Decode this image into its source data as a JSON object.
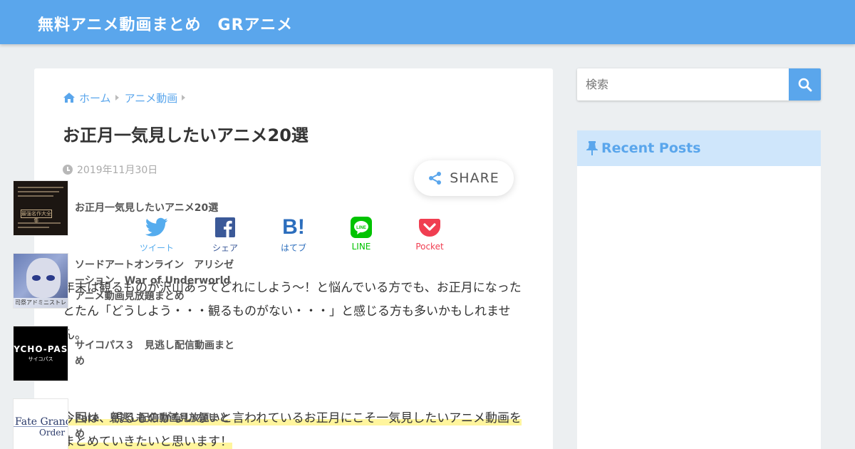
{
  "site": {
    "title": "無料アニメ動画まとめ　GRアニメ"
  },
  "breadcrumb": {
    "home": "ホーム",
    "category": "アニメ動画"
  },
  "post": {
    "title": "お正月一気見したいアニメ20選",
    "date": "2019年11月30日",
    "paragraph1": "年末は観るものが沢山あってどれにしよう～！と悩んでいる方でも、お正月になったとたん「どうしよう・・・観るものがない・・・」と感じる方も多いかもしれません。",
    "paragraph2": "今回は、観るものがないないと言われているお正月にこそ一気見したいアニメ動画をまとめていきたいと思います！"
  },
  "share": {
    "button_label": "SHARE",
    "items": [
      {
        "label": "ツイート",
        "icon": "twitter-icon",
        "color": "#55acee"
      },
      {
        "label": "シェア",
        "icon": "facebook-icon",
        "color": "#3b5998"
      },
      {
        "label": "はてブ",
        "icon": "hatena-bookmark-icon",
        "color": "#2c6ebd"
      },
      {
        "label": "LINE",
        "icon": "line-icon",
        "color": "#00c300"
      },
      {
        "label": "Pocket",
        "icon": "pocket-icon",
        "color": "#f03e51"
      }
    ]
  },
  "sidebar": {
    "search": {
      "placeholder": "検索"
    },
    "recent_posts": {
      "heading": "Recent Posts",
      "items": [
        {
          "title": "お正月一気見したいアニメ20選",
          "thumb_text": "最強名作大全集"
        },
        {
          "title": "ソードアートオンライン　アリシゼーション　War of Underworld　アニメ動画見放題まとめ",
          "thumb_text": "司祭アドミニストレータ"
        },
        {
          "title": "サイコパス３　見逃し配信動画まとめ",
          "thumb_text": "SYCHO-PASS",
          "thumb_subtext": "サイコパス"
        },
        {
          "title": "Fate　見逃し配信動画見放題まとめ",
          "thumb_text": "Fate Grand",
          "thumb_subtext": "Order"
        }
      ]
    }
  },
  "colors": {
    "accent": "#5aa6ec",
    "background": "#eceff1",
    "marker": "#fff59d"
  }
}
